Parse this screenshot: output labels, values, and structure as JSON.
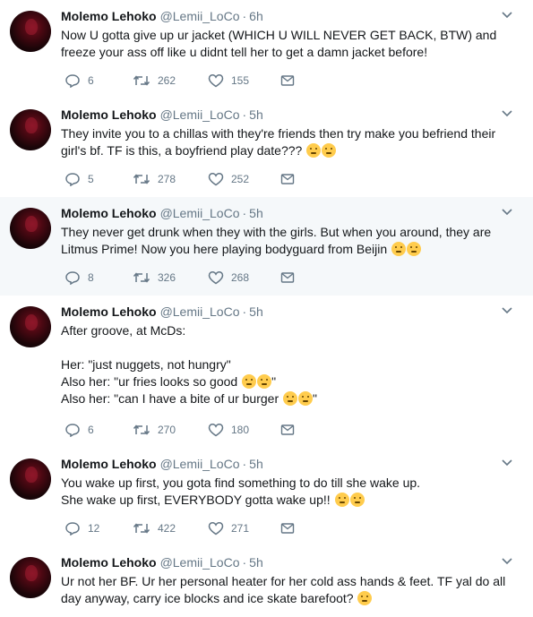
{
  "tweets": [
    {
      "name": "Molemo Lehoko",
      "handle": "@Lemii_LoCo",
      "dot": "·",
      "time": "6h",
      "lines": [
        "Now U gotta give up ur jacket (WHICH U WILL NEVER GET BACK, BTW) and",
        "freeze your ass off like u didnt tell her to get a damn jacket before!"
      ],
      "emojis": [],
      "replies": "6",
      "retweets": "262",
      "likes": "155"
    },
    {
      "name": "Molemo Lehoko",
      "handle": "@Lemii_LoCo",
      "dot": "·",
      "time": "5h",
      "lines": [
        "They invite you to a chillas with they're friends then try make you befriend their",
        "girl's bf. TF is this, a boyfriend play date???"
      ],
      "emojis": [
        "confused-face-emoji",
        "confused-face-emoji"
      ],
      "replies": "5",
      "retweets": "278",
      "likes": "252"
    },
    {
      "name": "Molemo Lehoko",
      "handle": "@Lemii_LoCo",
      "dot": "·",
      "time": "5h",
      "lines": [
        "They never get drunk when they with the girls. But when you around, they are",
        "Litmus Prime! Now you here playing bodyguard from Beijin"
      ],
      "emojis": [
        "unamused-face-emoji",
        "unamused-face-emoji"
      ],
      "replies": "8",
      "retweets": "326",
      "likes": "268"
    },
    {
      "name": "Molemo Lehoko",
      "handle": "@Lemii_LoCo",
      "dot": "·",
      "time": "5h",
      "lines": [
        "After groove, at McDs:",
        "",
        "Her: \"just nuggets, not hungry\"",
        "Also her: \"ur fries looks so good",
        "Also her: \"can I have a bite of ur burger"
      ],
      "line_suffix": "\"",
      "emojis": [
        "weary-face-emoji",
        "yum-face-emoji"
      ],
      "replies": "6",
      "retweets": "270",
      "likes": "180"
    },
    {
      "name": "Molemo Lehoko",
      "handle": "@Lemii_LoCo",
      "dot": "·",
      "time": "5h",
      "lines": [
        "You wake up first, you gota find something to do till she wake up.",
        "She wake up first, EVERYBODY gotta wake up!!"
      ],
      "emojis": [
        "unamused-face-emoji",
        "unamused-face-emoji"
      ],
      "replies": "12",
      "retweets": "422",
      "likes": "271"
    },
    {
      "name": "Molemo Lehoko",
      "handle": "@Lemii_LoCo",
      "dot": "·",
      "time": "5h",
      "lines": [
        "Ur not her BF. Ur her personal heater for her cold ass hands & feet. TF yal do all",
        "day anyway, carry ice blocks and ice skate barefoot?"
      ],
      "emojis": [
        "fearful-face-emoji"
      ],
      "replies": "",
      "retweets": "",
      "likes": ""
    }
  ],
  "colors": {
    "thread_line": "#7fd3da",
    "highlight_bg": "#f5f8fa",
    "secondary_text": "#657786",
    "primary_text": "#14171a",
    "emoji_yellow": "#ffcc4d"
  },
  "icons": {
    "reply": "reply-icon",
    "retweet": "retweet-icon",
    "like": "like-heart-icon",
    "dm": "direct-message-icon",
    "caret": "chevron-down-icon"
  }
}
